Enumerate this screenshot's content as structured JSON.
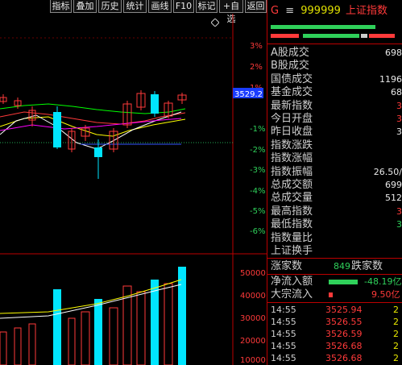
{
  "toolbar": {
    "buttons": [
      "指标",
      "叠加",
      "历史",
      "统计",
      "画线",
      "F10",
      "标记",
      "+自选",
      "返回"
    ],
    "diamond_icon": "diamond-icon"
  },
  "chart": {
    "price_axis": [
      "3%",
      "2%",
      "1%",
      "0%",
      "-1%",
      "-2%",
      "-3%",
      "-4%",
      "-5%",
      "-6%",
      "-7%",
      "-8%"
    ],
    "current_price_tag": "3529.2",
    "volume_axis": [
      "50000",
      "40000",
      "30000",
      "20000",
      "10000"
    ]
  },
  "panel": {
    "title_prefix": "G",
    "title_menu": "≡",
    "code": "999999",
    "name": "上证指数",
    "stats": [
      {
        "label": "A股成交",
        "value": "6985",
        "cls": "white"
      },
      {
        "label": "B股成交",
        "value": "2",
        "cls": "white"
      },
      {
        "label": "国债成交",
        "value": "11966",
        "cls": "white"
      },
      {
        "label": "基金成交",
        "value": "688",
        "cls": "white"
      },
      {
        "label": "最新指数",
        "value": "35",
        "cls": "red"
      },
      {
        "label": "今日开盘",
        "value": "35",
        "cls": "red"
      },
      {
        "label": "昨日收盘",
        "value": "35",
        "cls": "white"
      },
      {
        "label": "指数涨跌",
        "value": "",
        "cls": "white"
      },
      {
        "label": "指数涨幅",
        "value": "",
        "cls": "white"
      },
      {
        "label": "指数振幅",
        "value": "26.50/0",
        "cls": "white"
      },
      {
        "label": "总成交额",
        "value": "6991",
        "cls": "white"
      },
      {
        "label": "总成交量",
        "value": "5127",
        "cls": "white"
      },
      {
        "label": "最高指数",
        "value": "35",
        "cls": "red"
      },
      {
        "label": "最低指数",
        "value": "35",
        "cls": "green"
      },
      {
        "label": "指数量比",
        "value": "",
        "cls": "white"
      },
      {
        "label": "上证换手",
        "value": "",
        "cls": "white"
      }
    ],
    "rise_label": "涨家数",
    "fall_value": "849",
    "fall_label": "跌家数",
    "net_inflow_label": "净流入额",
    "net_inflow_value": "-48.19亿",
    "block_inflow_label": "大宗流入",
    "block_inflow_value": "9.50亿",
    "trades": [
      {
        "time": "14:55",
        "price": "3525.94",
        "vol": "2"
      },
      {
        "time": "14:55",
        "price": "3526.55",
        "vol": "2"
      },
      {
        "time": "14:55",
        "price": "3526.59",
        "vol": "2"
      },
      {
        "time": "14:55",
        "price": "3526.68",
        "vol": "2"
      },
      {
        "time": "14:55",
        "price": "3526.68",
        "vol": "2"
      }
    ]
  },
  "colors": {
    "up": "#ff3a3a",
    "down": "#00e5ff",
    "ma1": "#ffffff",
    "ma2": "#ffff00",
    "ma3": "#ff00ff",
    "ma4": "#00ff00"
  }
}
